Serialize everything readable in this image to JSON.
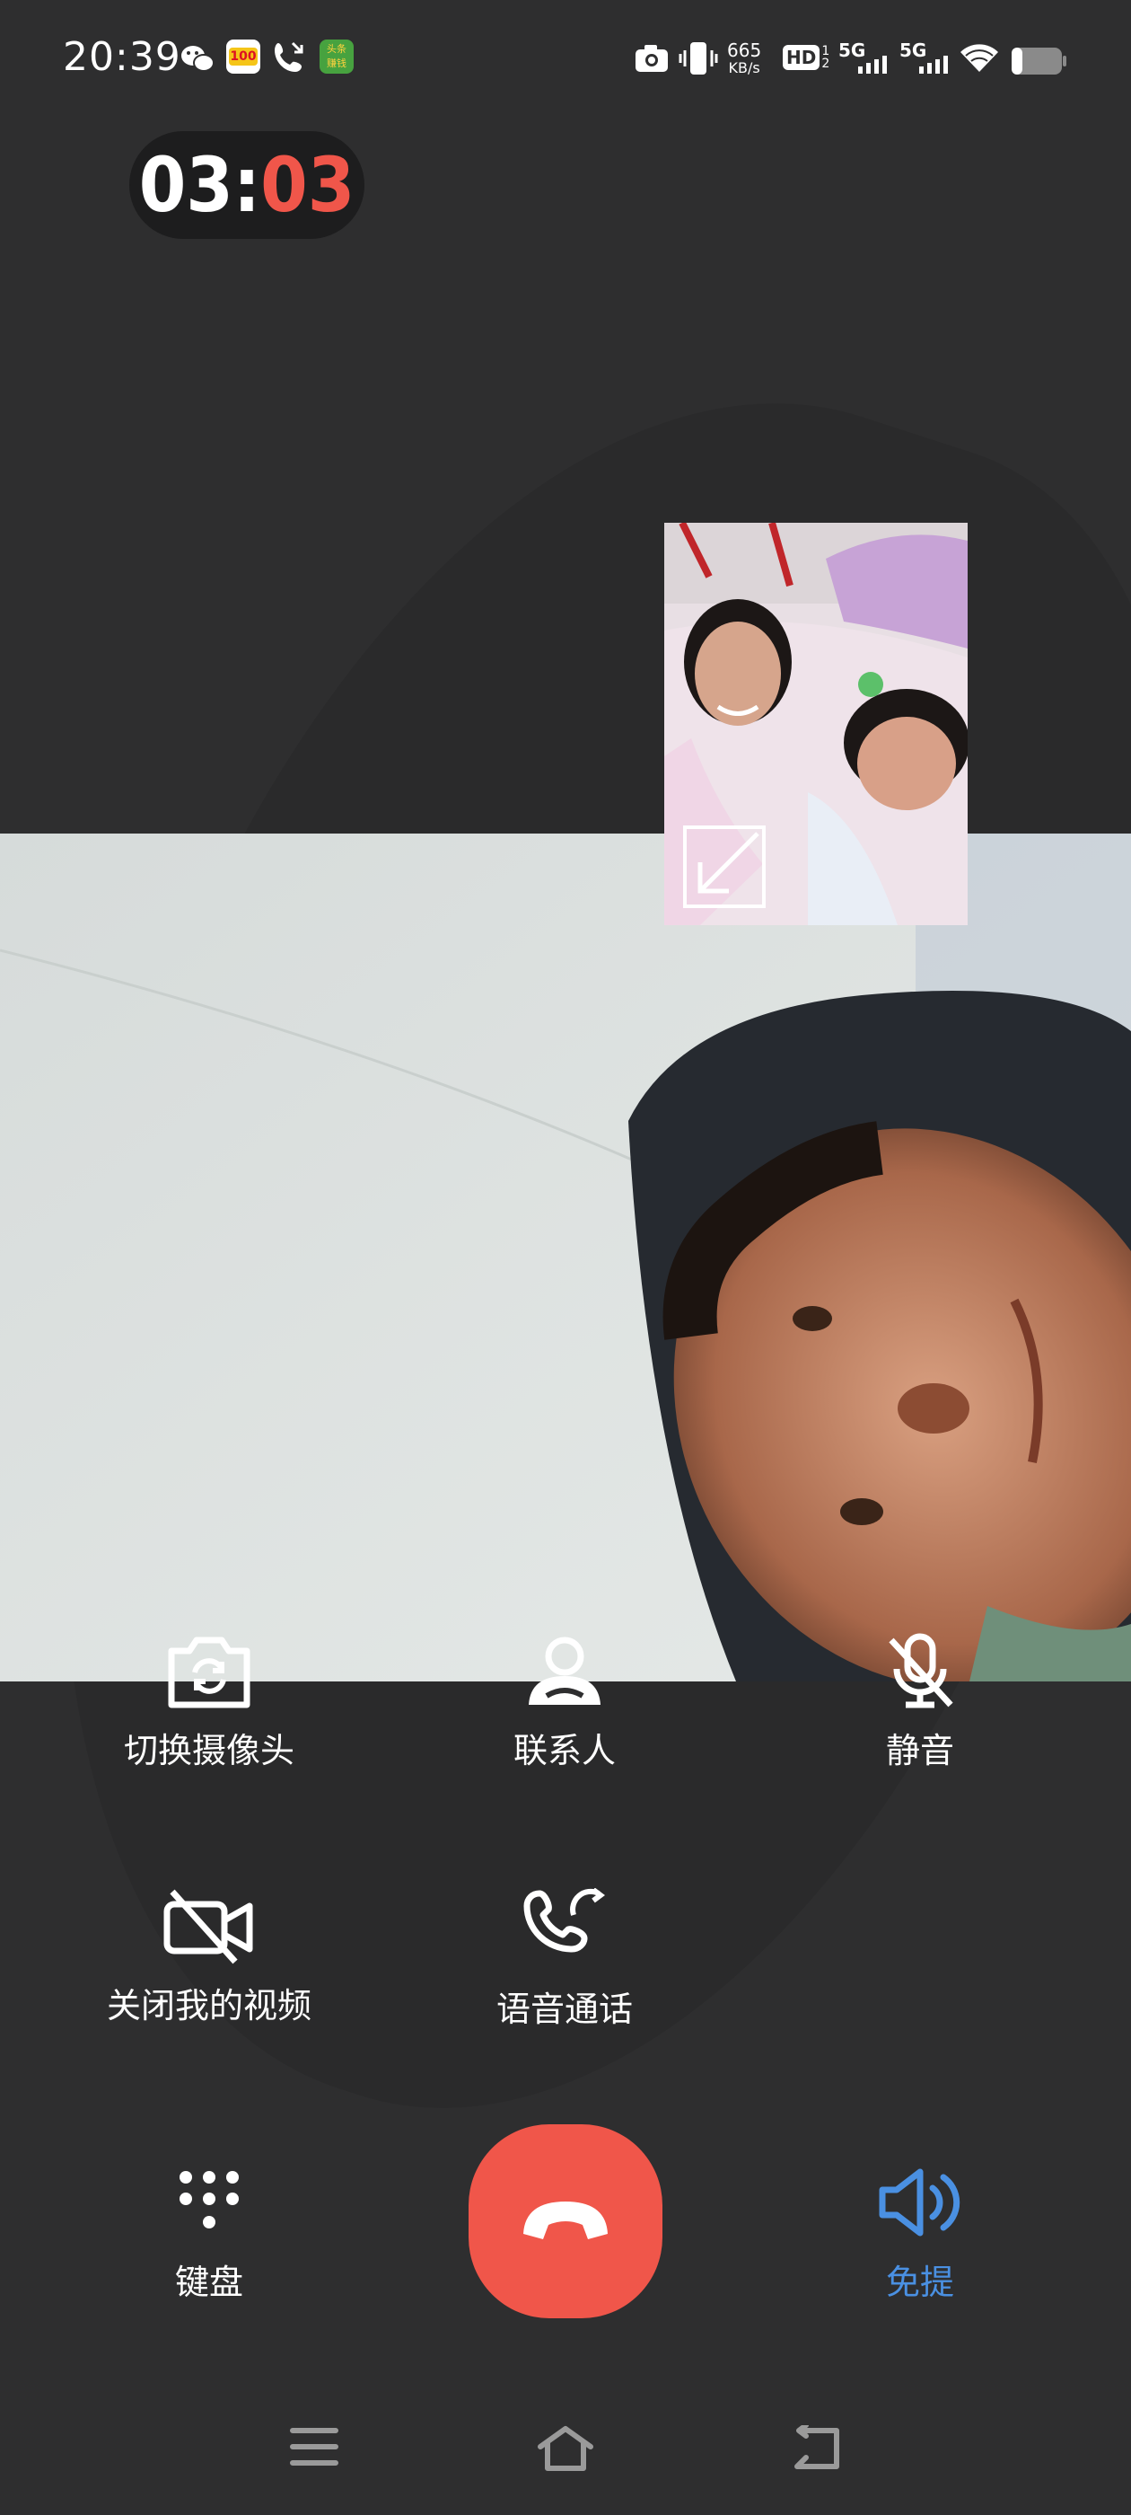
{
  "status_bar": {
    "time": "20:39",
    "net_speed_value": "665",
    "net_speed_unit": "KB/s",
    "hd_label": "HD",
    "sim1_label": "5G",
    "sim2_label": "5G",
    "icons": [
      "wechat-icon",
      "app-100-icon",
      "missed-call-icon",
      "app-toutiao-icon",
      "camera-icon",
      "vibrate-icon",
      "wifi-icon",
      "battery-icon"
    ]
  },
  "call": {
    "timer_minutes": "03",
    "timer_separator": ":",
    "timer_seconds": "03"
  },
  "controls": {
    "switch_camera": "切换摄像头",
    "contacts": "联系人",
    "mute": "静音",
    "turn_off_video": "关闭我的视频",
    "voice_call": "语音通话",
    "keypad": "键盘",
    "speaker": "免提"
  },
  "colors": {
    "background": "#2e2e2f",
    "end_call": "#f0564a",
    "speaker_active": "#4a90e2",
    "timer_seconds": "#f0564a"
  },
  "nav": {
    "icons": [
      "menu-icon",
      "home-icon",
      "back-icon"
    ]
  }
}
